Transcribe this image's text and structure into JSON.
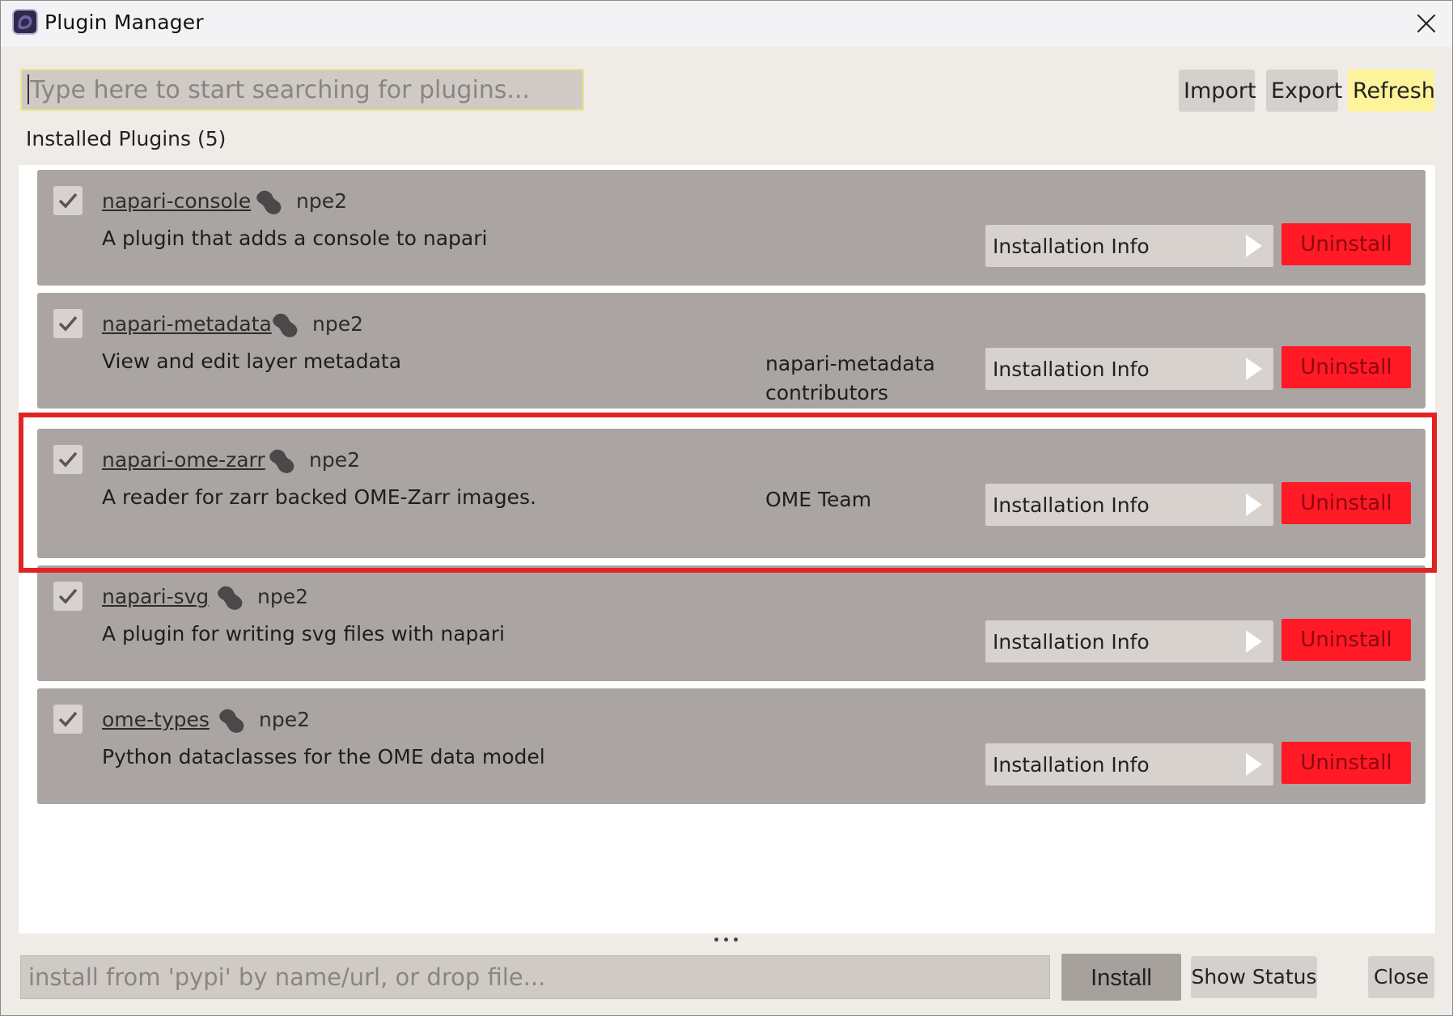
{
  "window": {
    "title": "Plugin Manager",
    "close_icon": "close-icon"
  },
  "search": {
    "placeholder": "Type here to start searching for plugins..."
  },
  "toolbar": {
    "import_label": "Import",
    "export_label": "Export",
    "refresh_label": "Refresh"
  },
  "installed": {
    "label": "Installed Plugins (5)"
  },
  "plugins": [
    {
      "name": "napari-console",
      "type": "npe2",
      "description": "A plugin that adds a console to napari",
      "author": "",
      "enabled": true,
      "info_label": "Installation Info",
      "uninstall_label": "Uninstall"
    },
    {
      "name": "napari-metadata",
      "type": "npe2",
      "description": "View and edit layer metadata",
      "author": "napari-metadata contributors",
      "enabled": true,
      "info_label": "Installation Info",
      "uninstall_label": "Uninstall"
    },
    {
      "name": "napari-ome-zarr",
      "type": "npe2",
      "description": "A reader for zarr backed OME-Zarr images.",
      "author": "OME Team",
      "enabled": true,
      "info_label": "Installation Info",
      "uninstall_label": "Uninstall"
    },
    {
      "name": "napari-svg",
      "type": "npe2",
      "description": "A plugin for writing svg files with napari",
      "author": "",
      "enabled": true,
      "info_label": "Installation Info",
      "uninstall_label": "Uninstall"
    },
    {
      "name": "ome-types",
      "type": "npe2",
      "description": "Python dataclasses for the OME data model",
      "author": "",
      "enabled": true,
      "info_label": "Installation Info",
      "uninstall_label": "Uninstall"
    }
  ],
  "footer": {
    "install_placeholder": "install from 'pypi' by name/url, or drop file...",
    "install_label": "Install",
    "show_status_label": "Show Status",
    "close_label": "Close"
  },
  "colors": {
    "uninstall": "#ff1a26",
    "refresh": "#fdf39a",
    "highlight": "#e02424",
    "card": "#aaa5a2"
  }
}
